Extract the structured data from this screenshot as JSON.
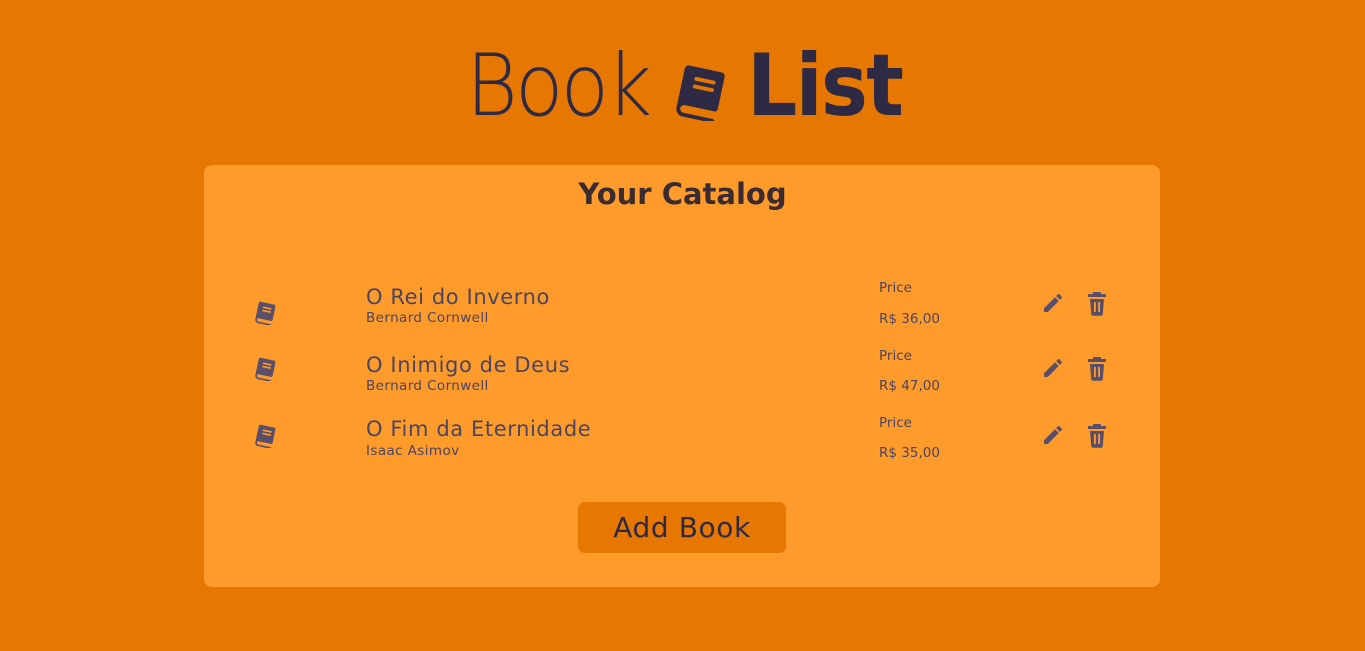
{
  "logo": {
    "word_light": "Book",
    "word_bold": "List",
    "icon": "book-icon"
  },
  "catalog": {
    "title": "Your Catalog",
    "price_label": "Price",
    "books": [
      {
        "title": "O Rei do Inverno",
        "author": "Bernard Cornwell",
        "price": "R$ 36,00"
      },
      {
        "title": "O Inimigo de Deus",
        "author": "Bernard Cornwell",
        "price": "R$ 47,00"
      },
      {
        "title": "O Fim da Eternidade",
        "author": "Isaac Asimov",
        "price": "R$ 35,00"
      }
    ],
    "row_icons": [
      "book-icon",
      "pencil-edit-icon",
      "trash-delete-icon"
    ]
  },
  "actions": {
    "add_label": "Add Book"
  },
  "colors": {
    "background": "#E67700",
    "card": "#FF9B2B",
    "text_dark": "#2E2A44",
    "button": "#E67700"
  }
}
